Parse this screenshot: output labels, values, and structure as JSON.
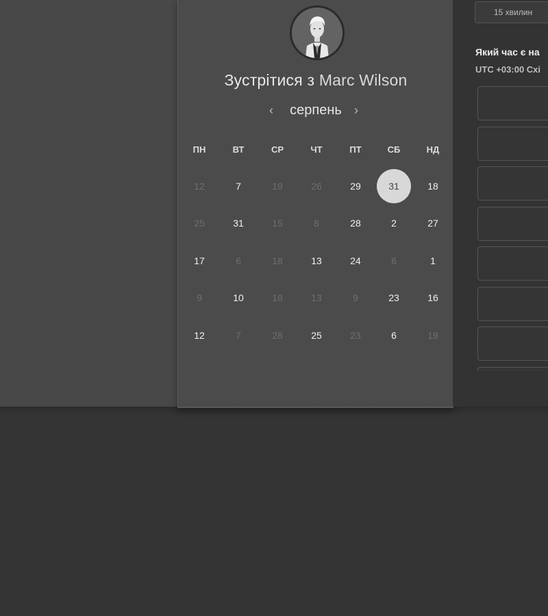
{
  "calendar": {
    "title_prefix": "Зустрітися з",
    "host_name": "Marc Wilson",
    "month": "серпень",
    "prev_icon": "chevron-left-icon",
    "next_icon": "chevron-right-icon",
    "weekdays": [
      "ПН",
      "ВТ",
      "СР",
      "ЧТ",
      "ПТ",
      "СБ",
      "НД"
    ],
    "weeks": [
      [
        {
          "d": "12",
          "a": false
        },
        {
          "d": "7",
          "a": true
        },
        {
          "d": "19",
          "a": false
        },
        {
          "d": "26",
          "a": false
        },
        {
          "d": "29",
          "a": true
        },
        {
          "d": "31",
          "a": true,
          "sel": true
        },
        {
          "d": "18",
          "a": true
        }
      ],
      [
        {
          "d": "25",
          "a": false
        },
        {
          "d": "31",
          "a": true
        },
        {
          "d": "15",
          "a": false
        },
        {
          "d": "8",
          "a": false
        },
        {
          "d": "28",
          "a": true
        },
        {
          "d": "2",
          "a": true
        },
        {
          "d": "27",
          "a": true
        }
      ],
      [
        {
          "d": "17",
          "a": true
        },
        {
          "d": "6",
          "a": false
        },
        {
          "d": "18",
          "a": false
        },
        {
          "d": "13",
          "a": true
        },
        {
          "d": "24",
          "a": true
        },
        {
          "d": "6",
          "a": false
        },
        {
          "d": "1",
          "a": true
        }
      ],
      [
        {
          "d": "9",
          "a": false
        },
        {
          "d": "10",
          "a": true
        },
        {
          "d": "18",
          "a": false
        },
        {
          "d": "13",
          "a": false
        },
        {
          "d": "9",
          "a": false
        },
        {
          "d": "23",
          "a": true
        },
        {
          "d": "16",
          "a": true
        }
      ],
      [
        {
          "d": "12",
          "a": true
        },
        {
          "d": "7",
          "a": false
        },
        {
          "d": "28",
          "a": false
        },
        {
          "d": "25",
          "a": true
        },
        {
          "d": "23",
          "a": false
        },
        {
          "d": "6",
          "a": true
        },
        {
          "d": "19",
          "a": false
        }
      ]
    ]
  },
  "scheduler": {
    "duration_label": "15 хвилин",
    "question": "Який час є на",
    "timezone_prefix": "UTC +03:00",
    "timezone_name": "Схі",
    "slots": [
      "",
      "",
      "",
      "",
      "",
      "",
      "",
      ""
    ]
  },
  "colors": {
    "background": "#343434",
    "panel": "#4b4b4b",
    "selected_day": "#d8d8d8"
  }
}
